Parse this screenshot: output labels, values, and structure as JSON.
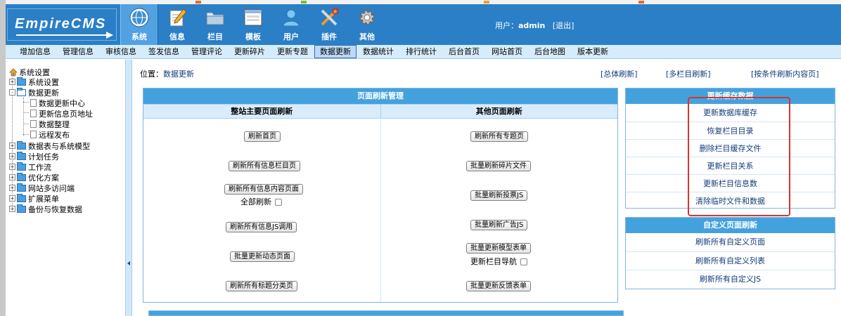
{
  "header": {
    "logo_text": "EmpireCMS",
    "main_nav": [
      {
        "label": "系统",
        "icon": "globe-icon",
        "active": true
      },
      {
        "label": "信息",
        "icon": "pencil-icon",
        "active": false
      },
      {
        "label": "栏目",
        "icon": "folder-icon",
        "active": false
      },
      {
        "label": "模板",
        "icon": "template-window-icon",
        "active": false
      },
      {
        "label": "用户",
        "icon": "user-icon",
        "active": false
      },
      {
        "label": "插件",
        "icon": "plugin-tools-icon",
        "active": false
      },
      {
        "label": "其他",
        "icon": "gear-icon",
        "active": false
      }
    ],
    "user_label": "用户：",
    "user_name": "admin",
    "logout": "[退出]"
  },
  "sub_nav": [
    {
      "label": "增加信息",
      "active": false
    },
    {
      "label": "管理信息",
      "active": false
    },
    {
      "label": "审核信息",
      "active": false
    },
    {
      "label": "签发信息",
      "active": false
    },
    {
      "label": "管理评论",
      "active": false
    },
    {
      "label": "更新碎片",
      "active": false
    },
    {
      "label": "更新专题",
      "active": false
    },
    {
      "label": "数据更新",
      "active": true
    },
    {
      "label": "数据统计",
      "active": false
    },
    {
      "label": "排行统计",
      "active": false
    },
    {
      "label": "后台首页",
      "active": false
    },
    {
      "label": "网站首页",
      "active": false
    },
    {
      "label": "后台地图",
      "active": false
    },
    {
      "label": "版本更新",
      "active": false
    }
  ],
  "sidebar": {
    "root": "系统设置",
    "items": [
      {
        "label": "系统设置",
        "expander": "+"
      },
      {
        "label": "数据更新",
        "expander": "-"
      },
      {
        "label": "数据更新中心",
        "child": true
      },
      {
        "label": "更新信息页地址",
        "child": true
      },
      {
        "label": "数据整理",
        "child": true
      },
      {
        "label": "远程发布",
        "child": true
      },
      {
        "label": "数据表与系统模型",
        "expander": "+"
      },
      {
        "label": "计划任务",
        "expander": "+"
      },
      {
        "label": "工作流",
        "expander": "+"
      },
      {
        "label": "优化方案",
        "expander": "+"
      },
      {
        "label": "网站多访问端",
        "expander": "+"
      },
      {
        "label": "扩展菜单",
        "expander": "+"
      },
      {
        "label": "备份与恢复数据",
        "expander": "+"
      }
    ]
  },
  "main": {
    "location_label": "位置：",
    "location_link": "数据更新",
    "top_links": [
      "[总体刷新]",
      "[多栏目刷新]",
      "[按条件刷新内容页]"
    ],
    "page_refresh": {
      "title": "页面刷新管理",
      "left_header": "整站主要页面刷新",
      "right_header": "其他页面刷新",
      "left_buttons": [
        "刷新首页",
        "刷新所有信息栏目页",
        "刷新所有信息内容页面",
        "刷新所有信息JS调用",
        "批量更新动态页面",
        "刷新所有标题分类页"
      ],
      "left_check_label": "全部刷新",
      "right_buttons": [
        "刷新所有专题页",
        "批量刷新碎片文件",
        "批量刷新投票JS",
        "批量刷新广告JS",
        "批量更新模型表单",
        "批量更新反馈表单"
      ],
      "right_check_label": "更新栏目导航"
    },
    "cache_panel": {
      "title": "更新缓存数据",
      "items": [
        "更新数据库缓存",
        "恢复栏目目录",
        "删除栏目缓存文件",
        "更新栏目关系",
        "更新栏目信息数",
        "清除临时文件和数据"
      ]
    },
    "custom_panel": {
      "title": "自定义页面刷新",
      "items": [
        "刷新所有自定义页面",
        "刷新所有自定义列表",
        "刷新所有自定义JS"
      ]
    }
  },
  "colors": {
    "header_bg": "#2a7fc6",
    "panel_head": "#43a2dd",
    "highlight_box": "#e0312a",
    "link": "#123c7c"
  }
}
